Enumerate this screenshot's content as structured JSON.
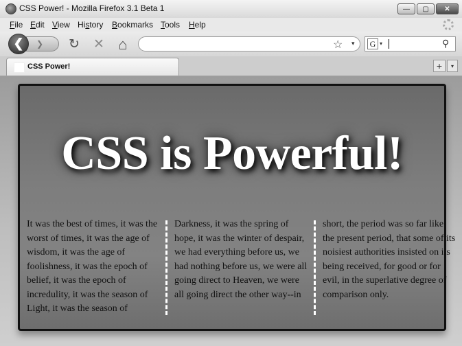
{
  "window": {
    "title": "CSS Power! - Mozilla Firefox 3.1 Beta 1",
    "minimize_glyph": "—",
    "maximize_glyph": "▢",
    "close_glyph": "✕"
  },
  "menu": {
    "items": [
      {
        "label_ul": "F",
        "label_rest": "ile"
      },
      {
        "label_ul": "E",
        "label_rest": "dit"
      },
      {
        "label_ul": "V",
        "label_rest": "iew"
      },
      {
        "label_pre": "Hi",
        "label_ul": "s",
        "label_rest": "tory"
      },
      {
        "label_ul": "B",
        "label_rest": "ookmarks"
      },
      {
        "label_ul": "T",
        "label_rest": "ools"
      },
      {
        "label_ul": "H",
        "label_rest": "elp"
      }
    ]
  },
  "toolbar": {
    "back_glyph": "❮",
    "forward_glyph": "❯",
    "reload_glyph": "↻",
    "stop_glyph": "✕",
    "home_glyph": "⌂",
    "bookmark_glyph": "☆",
    "dropdown_glyph": "▾",
    "url_value": "",
    "search_engine_glyph": "G",
    "search_value": "",
    "search_glyph": "⚲"
  },
  "tabs": [
    {
      "title": "CSS Power!"
    }
  ],
  "tab_controls": {
    "new_tab_glyph": "+",
    "list_glyph": "▾"
  },
  "page": {
    "headline": "CSS is Powerful!",
    "columns": [
      "It was the best of times, it was the worst of times, it was the age of wisdom, it was the age of foolishness, it was the epoch of belief, it was the epoch of incredulity, it was the season of Light, it was the season of",
      "Darkness, it was the spring of hope, it was the winter of despair, we had everything before us, we had nothing before us, we were all going direct to Heaven, we were all going direct the other way--in",
      "short, the period was so far like the present period, that some of its noisiest authorities insisted on its being received, for good or for evil, in the superlative degree of comparison only."
    ]
  },
  "icons": {
    "app": "firefox-icon",
    "throbber": "throbber-icon"
  }
}
